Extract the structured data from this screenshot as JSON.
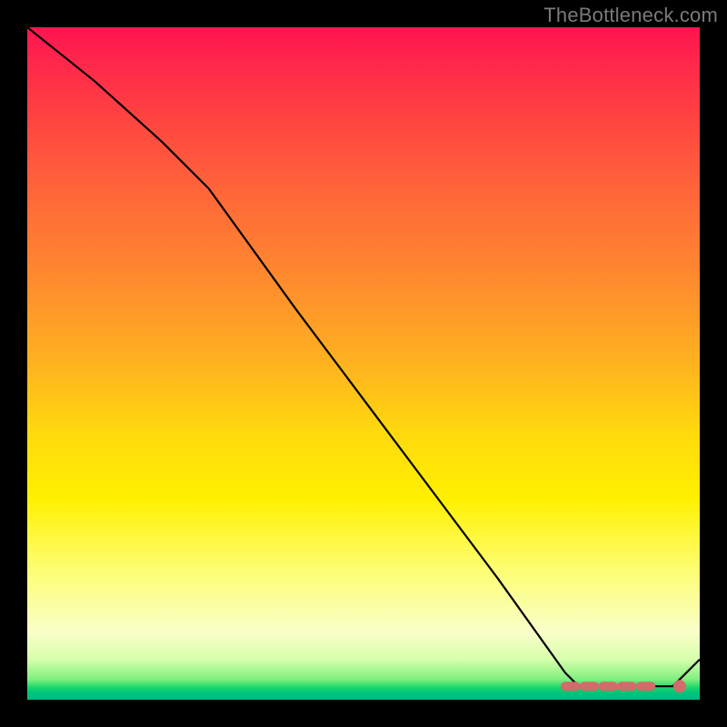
{
  "attribution": "TheBottleneck.com",
  "chart_data": {
    "type": "line",
    "title": "",
    "xlabel": "",
    "ylabel": "",
    "xlim": [
      0,
      100
    ],
    "ylim": [
      0,
      100
    ],
    "series": [
      {
        "name": "bottleneck-curve",
        "x": [
          0,
          10,
          20,
          27,
          40,
          55,
          70,
          80,
          82,
          84,
          88,
          92,
          96,
          100
        ],
        "values": [
          100,
          92,
          83,
          76,
          58,
          38,
          18,
          4,
          2,
          2,
          2,
          2,
          2,
          6
        ]
      }
    ],
    "markers": {
      "optimal_range": {
        "x_start": 80,
        "x_end": 94,
        "y": 2,
        "style": "dashed"
      },
      "point": {
        "x": 97,
        "y": 2
      }
    },
    "gradient_bands": [
      {
        "color": "#ff1450",
        "stop_pct": 0
      },
      {
        "color": "#ffb21f",
        "stop_pct": 50
      },
      {
        "color": "#fdfd6c",
        "stop_pct": 80
      },
      {
        "color": "#18d66a",
        "stop_pct": 98
      },
      {
        "color": "#00b98a",
        "stop_pct": 100
      }
    ]
  }
}
